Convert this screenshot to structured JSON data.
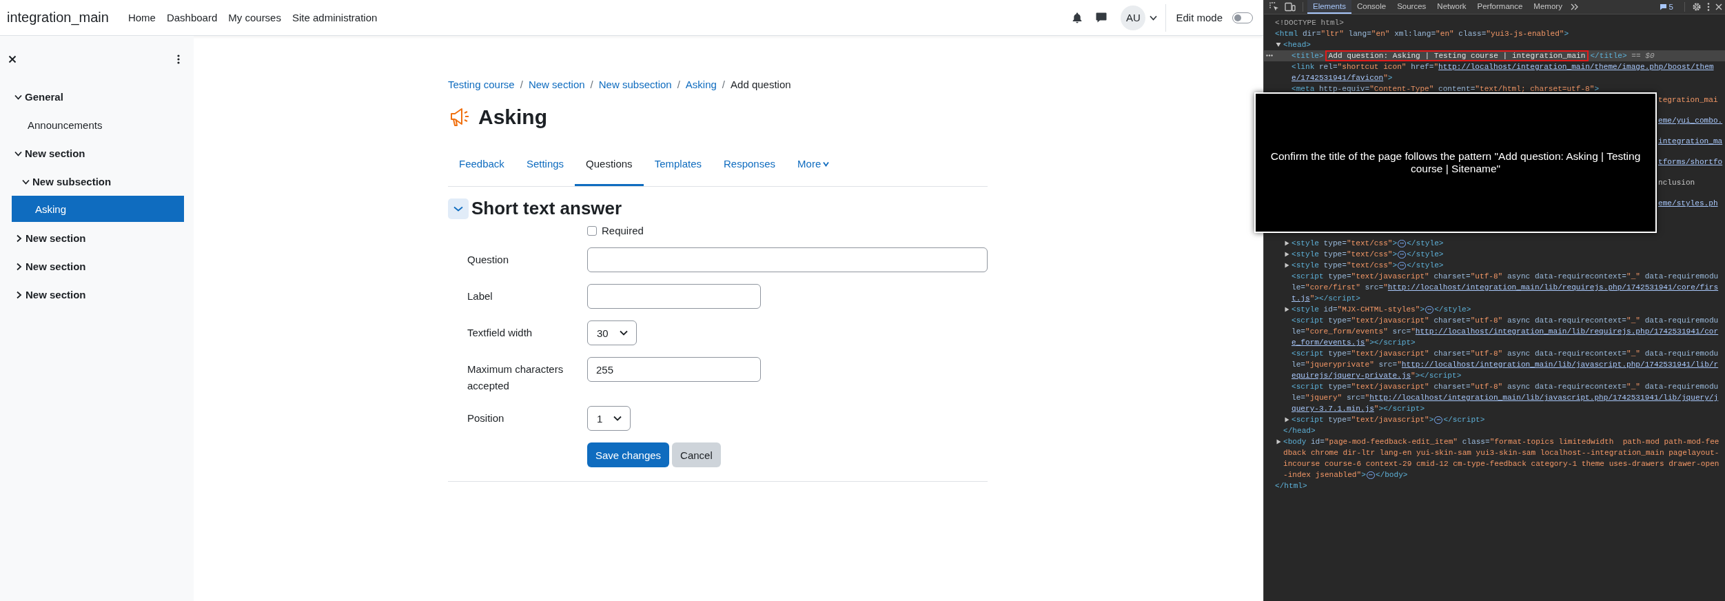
{
  "navbar": {
    "site_name": "integration_main",
    "links": [
      "Home",
      "Dashboard",
      "My courses",
      "Site administration"
    ],
    "avatar": "AU",
    "edit_mode": {
      "label": "Edit mode",
      "on": false
    }
  },
  "drawer": {
    "items": [
      {
        "label": "General",
        "kind": "section",
        "expanded": true,
        "selected": false,
        "children": [
          {
            "label": "Announcements",
            "kind": "activity",
            "selected": false
          }
        ]
      },
      {
        "label": "New section",
        "kind": "section",
        "expanded": true,
        "selected": false,
        "children": [
          {
            "label": "New subsection",
            "kind": "section",
            "expanded": true,
            "selected": false,
            "children": [
              {
                "label": "Asking",
                "kind": "activity",
                "selected": true
              }
            ]
          }
        ]
      },
      {
        "label": "New section",
        "kind": "section",
        "expanded": false,
        "selected": false
      },
      {
        "label": "New section",
        "kind": "section",
        "expanded": false,
        "selected": false
      },
      {
        "label": "New section",
        "kind": "section",
        "expanded": false,
        "selected": false
      }
    ]
  },
  "breadcrumb": [
    {
      "label": "Testing course",
      "link": true
    },
    {
      "label": "New section",
      "link": true
    },
    {
      "label": "New subsection",
      "link": true
    },
    {
      "label": "Asking",
      "link": true
    },
    {
      "label": "Add question",
      "link": false
    }
  ],
  "breadcrumb_separator": "/",
  "page_title": "Asking",
  "tabs": [
    {
      "label": "Feedback",
      "selected": false
    },
    {
      "label": "Settings",
      "selected": false
    },
    {
      "label": "Questions",
      "selected": true
    },
    {
      "label": "Templates",
      "selected": false
    },
    {
      "label": "Responses",
      "selected": false
    },
    {
      "label": "More",
      "selected": false,
      "dropdown": true
    }
  ],
  "form": {
    "title": "Short text answer",
    "expanded": true,
    "required": {
      "label": "Required",
      "checked": false
    },
    "fields": [
      {
        "label": "Question",
        "kind": "wide_text"
      },
      {
        "label": "Label",
        "kind": "text"
      },
      {
        "label": "Textfield width",
        "kind": "select",
        "value": "30"
      },
      {
        "label": "Maximum characters accepted",
        "kind": "text",
        "value": "255"
      },
      {
        "label": "Position",
        "kind": "select",
        "value": "1"
      }
    ],
    "buttons": [
      {
        "label": "Save changes",
        "kind": "primary"
      },
      {
        "label": "Cancel",
        "kind": "secondary"
      }
    ]
  },
  "devtools": {
    "tabs": [
      {
        "label": "Elements",
        "selected": true
      },
      {
        "label": "Console",
        "selected": false
      },
      {
        "label": "Sources",
        "selected": false
      },
      {
        "label": "Network",
        "selected": false
      },
      {
        "label": "Performance",
        "selected": false
      },
      {
        "label": "Memory",
        "selected": false
      }
    ],
    "issues_count": "5",
    "tree": [
      {
        "kind": "node",
        "selected": false,
        "segments": [
          {
            "kind": "doctype",
            "text": "<!DOCTYPE html>"
          }
        ]
      },
      {
        "kind": "node",
        "selected": false,
        "segments": [
          {
            "kind": "tag",
            "text": "<html"
          },
          {
            "kind": "attr",
            "text": " dir="
          },
          {
            "kind": "value",
            "text": "\"ltr\""
          },
          {
            "kind": "attr",
            "text": " lang="
          },
          {
            "kind": "value",
            "text": "\"en\""
          },
          {
            "kind": "attr",
            "text": " xml:lang="
          },
          {
            "kind": "value",
            "text": "\"en\""
          },
          {
            "kind": "attr",
            "text": " class="
          },
          {
            "kind": "value",
            "text": "\"yui3-js-enabled\""
          },
          {
            "kind": "tag",
            "text": ">"
          }
        ],
        "closing": [
          {
            "kind": "tag",
            "text": "</html>"
          }
        ],
        "children": [
          {
            "kind": "node",
            "selected": false,
            "expanded": true,
            "segments": [
              {
                "kind": "tag",
                "text": "<head>"
              }
            ],
            "closing": [
              {
                "kind": "tag",
                "text": "</head>"
              }
            ],
            "children": [
              {
                "kind": "node",
                "selected": true,
                "segments": [
                  {
                    "kind": "tag",
                    "text": "<title>"
                  },
                  {
                    "kind": "boxed",
                    "text": "Add question: Asking | Testing course | integration_main"
                  },
                  {
                    "kind": "tag",
                    "text": "</title>"
                  },
                  {
                    "kind": "marker",
                    "text": " == $0"
                  }
                ]
              },
              {
                "kind": "node",
                "selected": false,
                "segments": [
                  {
                    "kind": "tag",
                    "text": "<link"
                  },
                  {
                    "kind": "attr",
                    "text": " rel="
                  },
                  {
                    "kind": "value",
                    "text": "\"shortcut icon\""
                  },
                  {
                    "kind": "attr",
                    "text": " href="
                  },
                  {
                    "kind": "value",
                    "text": "\""
                  },
                  {
                    "kind": "link",
                    "text": "http://localhost/integration_main/theme/image.php/boost/theme/1742531941/favicon"
                  },
                  {
                    "kind": "value",
                    "text": "\""
                  },
                  {
                    "kind": "tag",
                    "text": ">"
                  }
                ]
              },
              {
                "kind": "node",
                "selected": false,
                "segments": [
                  {
                    "kind": "tag",
                    "text": "<meta"
                  },
                  {
                    "kind": "attr",
                    "text": " http-equiv="
                  },
                  {
                    "kind": "value",
                    "text": "\"Content-Type\""
                  },
                  {
                    "kind": "attr",
                    "text": " content="
                  },
                  {
                    "kind": "value",
                    "text": "\"text/html; charset=utf-8\""
                  },
                  {
                    "kind": "tag",
                    "text": ">"
                  }
                ]
              },
              {
                "kind": "covered",
                "fragments": [
                  {
                    "kind": "value",
                    "text": "tegration_mai"
                  },
                  {
                    "kind": "link",
                    "text": "eme/yui_combo."
                  },
                  {
                    "kind": "link",
                    "text": "integration_ma"
                  },
                  {
                    "kind": "link",
                    "text": "tforms/shortfo"
                  },
                  {
                    "kind": "text",
                    "text": "nclusion"
                  },
                  {
                    "kind": "link",
                    "text": "eme/styles.ph"
                  }
                ]
              },
              {
                "kind": "node",
                "selected": false,
                "expanded": false,
                "segments": [
                  {
                    "kind": "tag",
                    "text": "<style"
                  },
                  {
                    "kind": "attr",
                    "text": " type="
                  },
                  {
                    "kind": "value",
                    "text": "\"text/css\""
                  },
                  {
                    "kind": "tag",
                    "text": ">"
                  },
                  {
                    "kind": "ellipsis",
                    "text": "⋯"
                  },
                  {
                    "kind": "tag",
                    "text": "</style>"
                  }
                ]
              },
              {
                "kind": "node",
                "selected": false,
                "expanded": false,
                "segments": [
                  {
                    "kind": "tag",
                    "text": "<style"
                  },
                  {
                    "kind": "attr",
                    "text": " type="
                  },
                  {
                    "kind": "value",
                    "text": "\"text/css\""
                  },
                  {
                    "kind": "tag",
                    "text": ">"
                  },
                  {
                    "kind": "ellipsis",
                    "text": "⋯"
                  },
                  {
                    "kind": "tag",
                    "text": "</style>"
                  }
                ]
              },
              {
                "kind": "node",
                "selected": false,
                "expanded": false,
                "segments": [
                  {
                    "kind": "tag",
                    "text": "<style"
                  },
                  {
                    "kind": "attr",
                    "text": " type="
                  },
                  {
                    "kind": "value",
                    "text": "\"text/css\""
                  },
                  {
                    "kind": "tag",
                    "text": ">"
                  },
                  {
                    "kind": "ellipsis",
                    "text": "⋯"
                  },
                  {
                    "kind": "tag",
                    "text": "</style>"
                  }
                ]
              },
              {
                "kind": "node",
                "selected": false,
                "segments": [
                  {
                    "kind": "tag",
                    "text": "<script"
                  },
                  {
                    "kind": "attr",
                    "text": " type="
                  },
                  {
                    "kind": "value",
                    "text": "\"text/javascript\""
                  },
                  {
                    "kind": "attr",
                    "text": " charset="
                  },
                  {
                    "kind": "value",
                    "text": "\"utf-8\""
                  },
                  {
                    "kind": "attr",
                    "text": " async data-requirecontext="
                  },
                  {
                    "kind": "value",
                    "text": "\"_\""
                  },
                  {
                    "kind": "attr",
                    "text": " data-requiremodule="
                  },
                  {
                    "kind": "value",
                    "text": "\"core/first\""
                  },
                  {
                    "kind": "attr",
                    "text": " src="
                  },
                  {
                    "kind": "value",
                    "text": "\""
                  },
                  {
                    "kind": "link",
                    "text": "http://localhost/integration_main/lib/requirejs.php/1742531941/core/first.js"
                  },
                  {
                    "kind": "value",
                    "text": "\""
                  },
                  {
                    "kind": "tag",
                    "text": "></script>"
                  }
                ]
              },
              {
                "kind": "node",
                "selected": false,
                "expanded": false,
                "segments": [
                  {
                    "kind": "tag",
                    "text": "<style"
                  },
                  {
                    "kind": "attr",
                    "text": " id="
                  },
                  {
                    "kind": "value",
                    "text": "\"MJX-CHTML-styles\""
                  },
                  {
                    "kind": "tag",
                    "text": ">"
                  },
                  {
                    "kind": "ellipsis",
                    "text": "⋯"
                  },
                  {
                    "kind": "tag",
                    "text": "</style>"
                  }
                ]
              },
              {
                "kind": "node",
                "selected": false,
                "segments": [
                  {
                    "kind": "tag",
                    "text": "<script"
                  },
                  {
                    "kind": "attr",
                    "text": " type="
                  },
                  {
                    "kind": "value",
                    "text": "\"text/javascript\""
                  },
                  {
                    "kind": "attr",
                    "text": " charset="
                  },
                  {
                    "kind": "value",
                    "text": "\"utf-8\""
                  },
                  {
                    "kind": "attr",
                    "text": " async data-requirecontext="
                  },
                  {
                    "kind": "value",
                    "text": "\"_\""
                  },
                  {
                    "kind": "attr",
                    "text": " data-requiremodule="
                  },
                  {
                    "kind": "value",
                    "text": "\"core_form/events\""
                  },
                  {
                    "kind": "attr",
                    "text": " src="
                  },
                  {
                    "kind": "value",
                    "text": "\""
                  },
                  {
                    "kind": "link",
                    "text": "http://localhost/integration_main/lib/requirejs.php/1742531941/core_form/events.js"
                  },
                  {
                    "kind": "value",
                    "text": "\""
                  },
                  {
                    "kind": "tag",
                    "text": "></script>"
                  }
                ]
              },
              {
                "kind": "node",
                "selected": false,
                "segments": [
                  {
                    "kind": "tag",
                    "text": "<script"
                  },
                  {
                    "kind": "attr",
                    "text": " type="
                  },
                  {
                    "kind": "value",
                    "text": "\"text/javascript\""
                  },
                  {
                    "kind": "attr",
                    "text": " charset="
                  },
                  {
                    "kind": "value",
                    "text": "\"utf-8\""
                  },
                  {
                    "kind": "attr",
                    "text": " async data-requirecontext="
                  },
                  {
                    "kind": "value",
                    "text": "\"_\""
                  },
                  {
                    "kind": "attr",
                    "text": " data-requiremodule="
                  },
                  {
                    "kind": "value",
                    "text": "\"jqueryprivate\""
                  },
                  {
                    "kind": "attr",
                    "text": " src="
                  },
                  {
                    "kind": "value",
                    "text": "\""
                  },
                  {
                    "kind": "link",
                    "text": "http://localhost/integration_main/lib/javascript.php/1742531941/lib/requirejs/jquery-private.js"
                  },
                  {
                    "kind": "value",
                    "text": "\""
                  },
                  {
                    "kind": "tag",
                    "text": "></script>"
                  }
                ]
              },
              {
                "kind": "node",
                "selected": false,
                "segments": [
                  {
                    "kind": "tag",
                    "text": "<script"
                  },
                  {
                    "kind": "attr",
                    "text": " type="
                  },
                  {
                    "kind": "value",
                    "text": "\"text/javascript\""
                  },
                  {
                    "kind": "attr",
                    "text": " charset="
                  },
                  {
                    "kind": "value",
                    "text": "\"utf-8\""
                  },
                  {
                    "kind": "attr",
                    "text": " async data-requirecontext="
                  },
                  {
                    "kind": "value",
                    "text": "\"_\""
                  },
                  {
                    "kind": "attr",
                    "text": " data-requiremodule="
                  },
                  {
                    "kind": "value",
                    "text": "\"jquery\""
                  },
                  {
                    "kind": "attr",
                    "text": " src="
                  },
                  {
                    "kind": "value",
                    "text": "\""
                  },
                  {
                    "kind": "link",
                    "text": "http://localhost/integration_main/lib/javascript.php/1742531941/lib/jquery/jquery-3.7.1.min.js"
                  },
                  {
                    "kind": "value",
                    "text": "\""
                  },
                  {
                    "kind": "tag",
                    "text": "></script>"
                  }
                ]
              },
              {
                "kind": "node",
                "selected": false,
                "expanded": false,
                "segments": [
                  {
                    "kind": "tag",
                    "text": "<script"
                  },
                  {
                    "kind": "attr",
                    "text": " type="
                  },
                  {
                    "kind": "value",
                    "text": "\"text/javascript\""
                  },
                  {
                    "kind": "tag",
                    "text": ">"
                  },
                  {
                    "kind": "ellipsis",
                    "text": "⋯"
                  },
                  {
                    "kind": "tag",
                    "text": "</script>"
                  }
                ]
              }
            ]
          },
          {
            "kind": "node",
            "selected": false,
            "expanded": false,
            "segments": [
              {
                "kind": "tag",
                "text": "<body"
              },
              {
                "kind": "attr",
                "text": " id="
              },
              {
                "kind": "value",
                "text": "\"page-mod-feedback-edit_item\""
              },
              {
                "kind": "attr",
                "text": " class="
              },
              {
                "kind": "value",
                "text": "\"format-topics limitedwidth  path-mod path-mod-feedback chrome dir-ltr lang-en yui-skin-sam yui3-skin-sam localhost--integration_main pagelayout-incourse course-6 context-29 cmid-12 cm-type-feedback category-1 theme uses-drawers drawer-open-index jsenabled\""
              },
              {
                "kind": "tag",
                "text": ">"
              },
              {
                "kind": "ellipsis",
                "text": "⋯"
              },
              {
                "kind": "tag",
                "text": "</body>"
              }
            ]
          }
        ]
      }
    ],
    "overlay": {
      "text": "Confirm the title of the page follows the pattern \"Add question: Asking | Testing course | Sitename\""
    }
  }
}
